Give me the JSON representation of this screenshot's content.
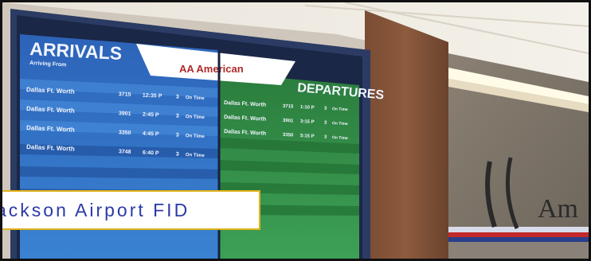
{
  "scene": {
    "caption": "ackson Airport FID",
    "arrivals_title": "ARRIVALS",
    "arrivals_subtitle": "Arriving From",
    "departures_title": "DEPARTURES",
    "airline_logo": "AA American",
    "wall_sign": "Am",
    "arrival_rows": [
      {
        "city": "Dallas Ft. Worth",
        "flight": "3715",
        "time": "12:35 P",
        "gate": "3",
        "status": "On Time"
      },
      {
        "city": "Dallas Ft. Worth",
        "flight": "3901",
        "time": "2:45 P",
        "gate": "3",
        "status": "On Time"
      },
      {
        "city": "Dallas Ft. Worth",
        "flight": "3350",
        "time": "4:45 P",
        "gate": "3",
        "status": "On Time"
      },
      {
        "city": "Dallas Ft. Worth",
        "flight": "3748",
        "time": "6:40 P",
        "gate": "3",
        "status": "On Time"
      }
    ],
    "departure_rows": [
      {
        "city": "Dallas Ft. Worth",
        "flight": "3715",
        "time": "1:10 P",
        "gate": "3",
        "status": "On Time"
      },
      {
        "city": "Dallas Ft. Worth",
        "flight": "3901",
        "time": "3:15 P",
        "gate": "3",
        "status": "On Time"
      },
      {
        "city": "Dallas Ft. Worth",
        "flight": "3350",
        "time": "5:15 P",
        "gate": "3",
        "status": "On Time"
      }
    ],
    "colors": {
      "caption_text": "#2b3aa8",
      "caption_border": "#e0b21a",
      "arrivals_panel": "#2f6fc0",
      "departures_panel": "#2f8a45"
    }
  }
}
